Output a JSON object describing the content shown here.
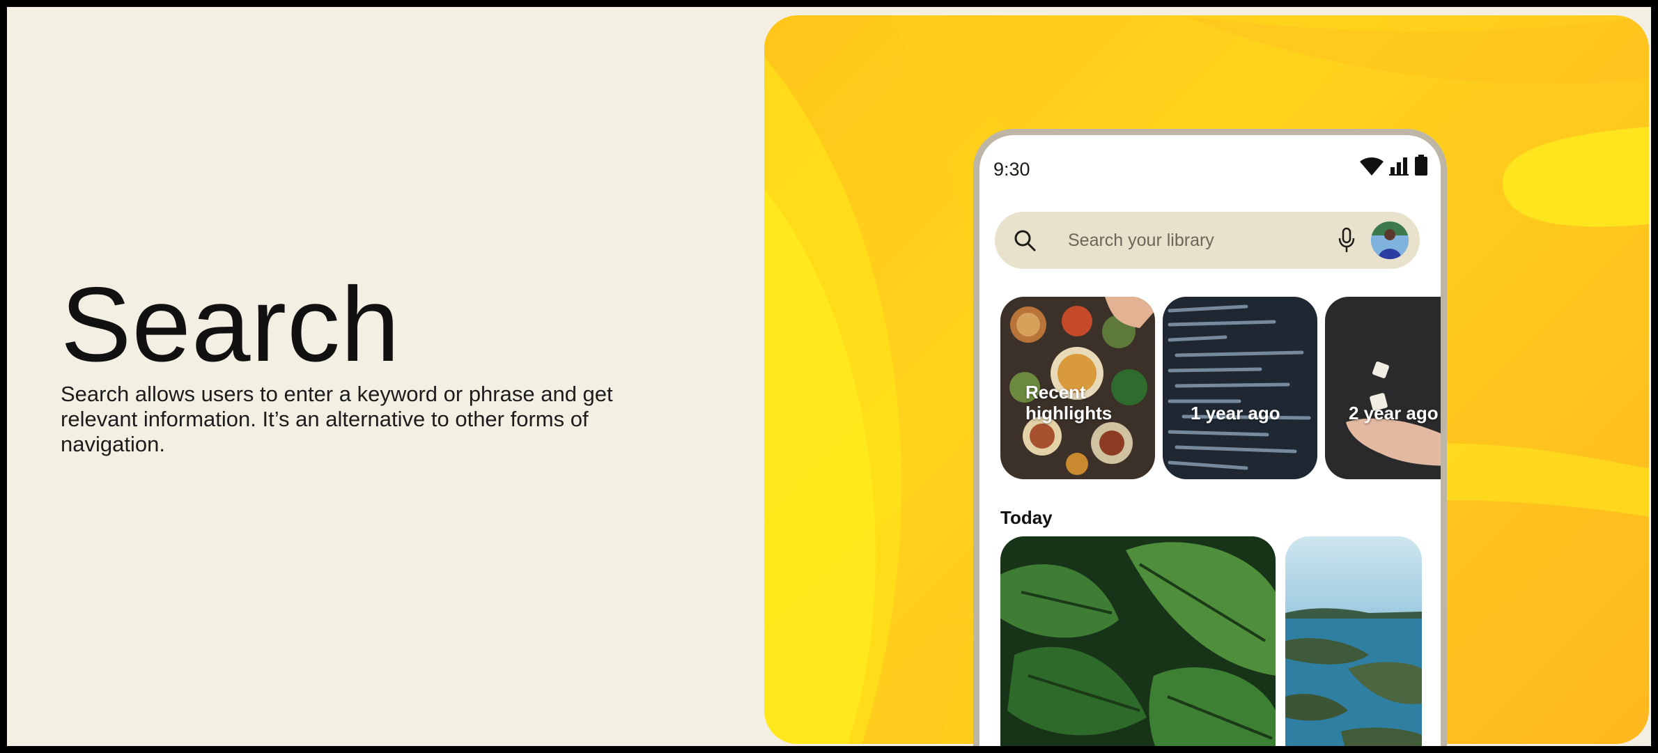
{
  "page": {
    "title": "Search",
    "description": "Search allows users to enter a keyword or phrase and get relevant information. It’s an alternative to other forms of navigation."
  },
  "phone": {
    "status_time": "9:30",
    "status_icons": [
      "wifi-icon",
      "signal-icon",
      "battery-icon"
    ],
    "search": {
      "placeholder": "Search your library",
      "icons": [
        "search-icon",
        "mic-icon",
        "avatar"
      ]
    },
    "memories": [
      {
        "label": "Recent highlights",
        "image": "food-table-photo"
      },
      {
        "label": "1 year ago",
        "image": "code-screen-photo"
      },
      {
        "label": "2 year ago",
        "image": "dice-hand-photo"
      }
    ],
    "section_title": "Today",
    "photos": [
      "monstera-leaves-photo",
      "coast-aerial-photo"
    ]
  },
  "colors": {
    "page_background": "#f3efe3",
    "hero_yellow": "#ffc61a",
    "search_bar": "#e8e2cc",
    "phone_frame": "#bdb5a5"
  }
}
